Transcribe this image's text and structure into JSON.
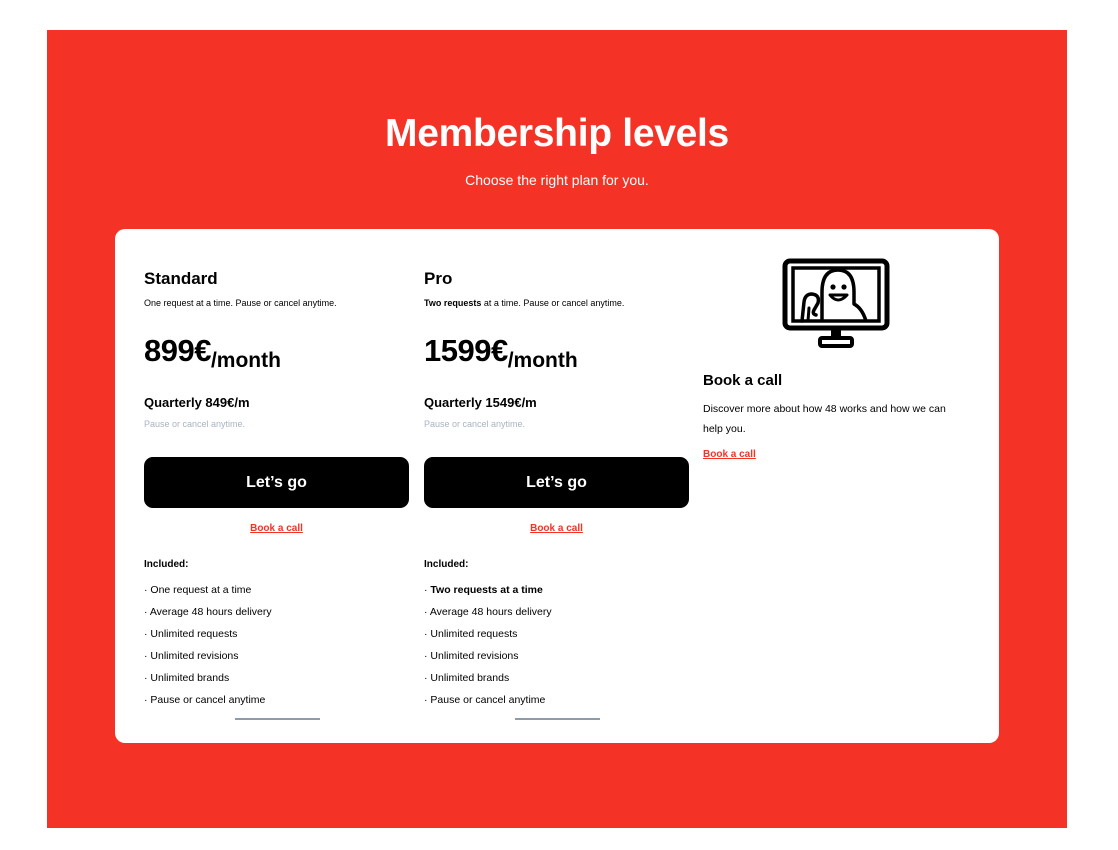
{
  "header": {
    "title": "Membership levels",
    "subtitle": "Choose the right plan for you."
  },
  "plans": [
    {
      "name": "Standard",
      "description_strong": "",
      "description": "One request at a time. Pause or cancel anytime.",
      "price": "899€",
      "period": "/month",
      "quarterly": "Quarterly 849€/m",
      "pause_note": "Pause or cancel anytime.",
      "cta": "Let’s go",
      "book_link": "Book a call",
      "included_title": "Included:",
      "features": [
        "· One request at a time",
        "· Average 48 hours delivery",
        "· Unlimited requests",
        "· Unlimited revisions",
        "· Unlimited brands",
        "· Pause or cancel anytime"
      ]
    },
    {
      "name": "Pro",
      "description_strong": "Two requests",
      "description": " at a time. Pause or cancel anytime.",
      "price": "1599€",
      "period": "/month",
      "quarterly": "Quarterly 1549€/m",
      "pause_note": "Pause or cancel anytime.",
      "cta": "Let’s go",
      "book_link": "Book a call",
      "included_title": "Included:",
      "features_first_prefix": "· ",
      "features_first_strong": "Two requests at a time",
      "features": [
        "· Average 48 hours delivery",
        "· Unlimited requests",
        "· Unlimited revisions",
        "· Unlimited brands",
        "· Pause or cancel anytime"
      ]
    }
  ],
  "call_panel": {
    "icon": "smiling-person-monitor-icon",
    "title": "Book a call",
    "text": "Discover more about how 48 works and how we can help you.",
    "link": "Book a call"
  },
  "colors": {
    "brand_red": "#f43326",
    "button_black": "#000000",
    "muted_gray": "#a9b4c2",
    "divider_gray": "#8e9bab"
  }
}
